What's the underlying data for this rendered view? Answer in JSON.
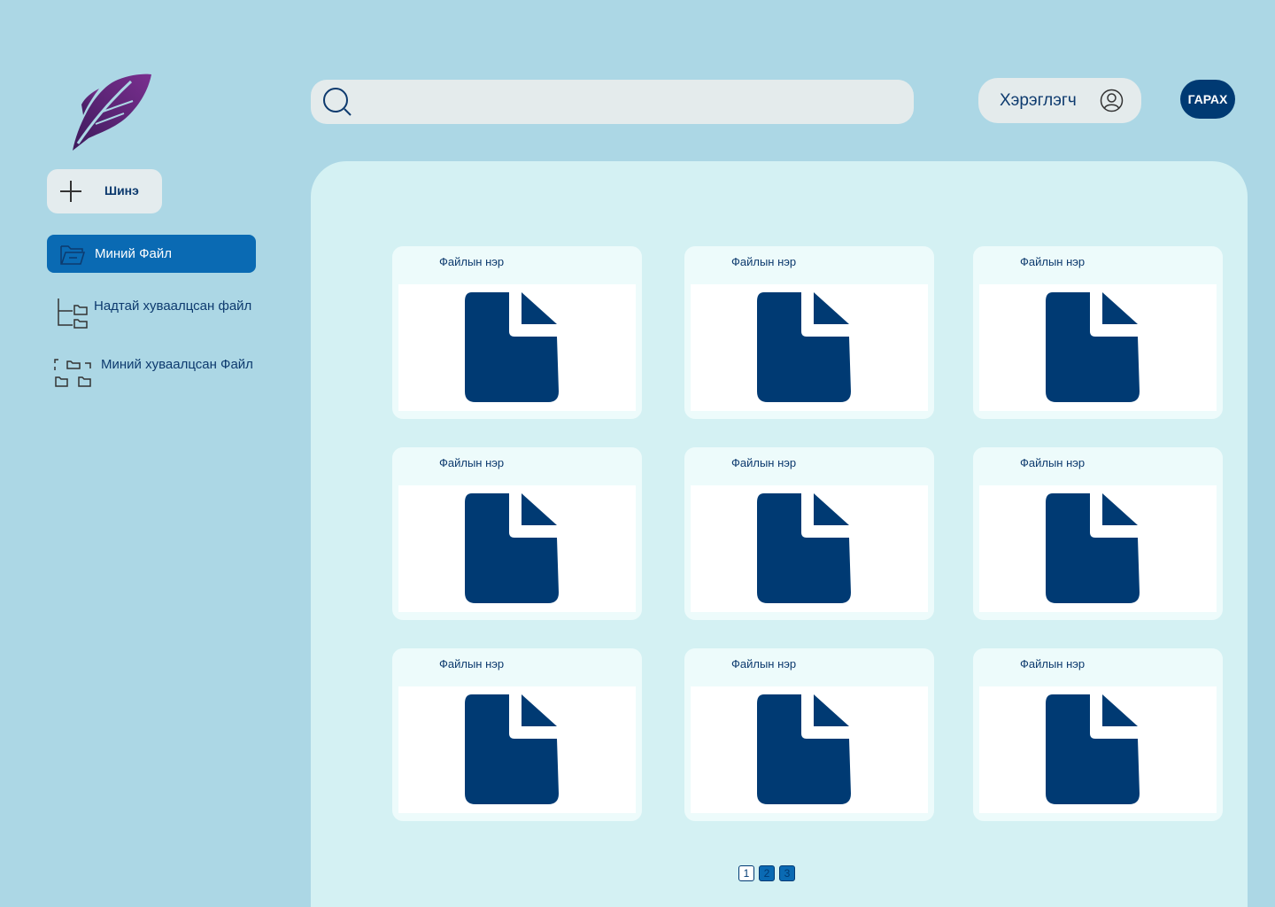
{
  "brand": {
    "logo_icon": "feather-logo-icon",
    "colors": {
      "purple_dark": "#3d1a5c",
      "purple": "#6b2a8f",
      "accent": "#0a6ab3",
      "navy": "#003a73"
    }
  },
  "sidebar": {
    "new_label": "Шинэ",
    "items": [
      {
        "label": "Миний Файл",
        "icon": "folder-open-icon",
        "active": true
      },
      {
        "label": "Надтай хуваалцсан файл",
        "icon": "folder-tree-icon",
        "active": false
      },
      {
        "label": "Миний хуваалцсан Файл",
        "icon": "shared-folders-icon",
        "active": false
      }
    ]
  },
  "header": {
    "search_placeholder": "",
    "user_label": "Хэрэглэгч",
    "logout_label": "ГАРАХ"
  },
  "files": [
    {
      "name": "Файлын нэр"
    },
    {
      "name": "Файлын нэр"
    },
    {
      "name": "Файлын нэр"
    },
    {
      "name": "Файлын нэр"
    },
    {
      "name": "Файлын нэр"
    },
    {
      "name": "Файлын нэр"
    },
    {
      "name": "Файлын нэр"
    },
    {
      "name": "Файлын нэр"
    },
    {
      "name": "Файлын нэр"
    }
  ],
  "pagination": {
    "pages": [
      "1",
      "2",
      "3"
    ],
    "current": "1"
  }
}
